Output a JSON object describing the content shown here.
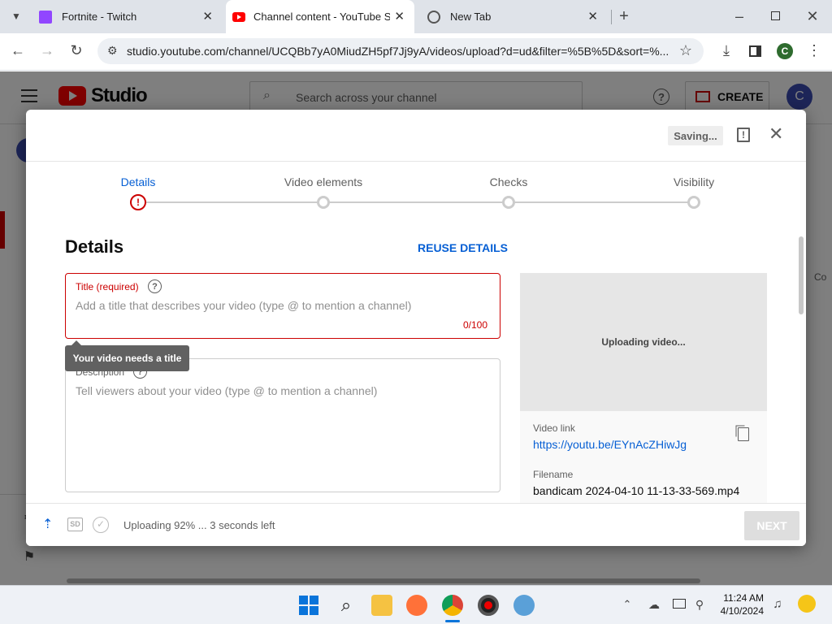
{
  "browser": {
    "tabs": [
      {
        "label": "Fortnite - Twitch",
        "icon": "twitch-icon"
      },
      {
        "label": "Channel content - YouTube Studio",
        "icon": "youtube-icon",
        "active": true
      },
      {
        "label": "New Tab",
        "icon": "chrome-icon"
      }
    ],
    "url": "studio.youtube.com/channel/UCQBb7yA0MiudZH5pf7Jj9yA/videos/upload?d=ud&filter=%5B%5D&sort=%...",
    "profile_initial": "C"
  },
  "studio": {
    "logo_text": "Studio",
    "search_placeholder": "Search across your channel",
    "create_label": "CREATE",
    "avatar_initial": "C",
    "side_fragment": "Co"
  },
  "dialog": {
    "saving_label": "Saving...",
    "steps": [
      "Details",
      "Video elements",
      "Checks",
      "Visibility"
    ],
    "heading": "Details",
    "reuse_label": "REUSE DETAILS",
    "title_label": "Title (required)",
    "title_placeholder": "Add a title that describes your video (type @ to mention a channel)",
    "title_counter": "0/100",
    "tooltip": "Your video needs a title",
    "description_label": "Description",
    "description_placeholder": "Tell viewers about your video (type @ to mention a channel)",
    "preview_status": "Uploading video...",
    "video_link_label": "Video link",
    "video_link": "https://youtu.be/EYnAcZHiwJg",
    "filename_label": "Filename",
    "filename": "bandicam 2024-04-10 11-13-33-569.mp4",
    "upload_status": "Uploading 92% ... 3 seconds left",
    "sd_badge": "SD",
    "next_label": "NEXT"
  },
  "taskbar": {
    "time": "11:24 AM",
    "date": "4/10/2024"
  },
  "colors": {
    "accent": "#065fd4",
    "error": "#cc0000",
    "youtube_red": "#ff0000"
  }
}
